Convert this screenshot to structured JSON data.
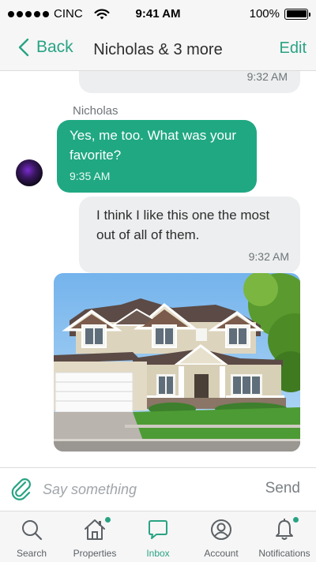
{
  "status_bar": {
    "carrier": "CINC",
    "time": "9:41 AM",
    "battery": "100%",
    "battery_level": 1.0
  },
  "nav": {
    "back_label": "Back",
    "title": "Nicholas & 3 more",
    "edit_label": "Edit"
  },
  "messages": [
    {
      "direction": "outgoing",
      "text": "",
      "time": "9:32 AM"
    },
    {
      "direction": "incoming",
      "sender": "Nicholas",
      "text": "Yes, me too. What was your favorite?",
      "time": "9:35 AM"
    },
    {
      "direction": "outgoing",
      "text": "I think I like this one the most out of all of them.",
      "time": "9:32 AM"
    },
    {
      "direction": "incoming",
      "type": "image",
      "image_icon": "house-photo"
    }
  ],
  "composer": {
    "placeholder": "Say something",
    "value": "",
    "send_label": "Send",
    "attach_icon": "paperclip-icon"
  },
  "tabs": [
    {
      "label": "Search",
      "icon": "search-icon",
      "active": false,
      "badge": false
    },
    {
      "label": "Properties",
      "icon": "house-icon",
      "active": false,
      "badge": true
    },
    {
      "label": "Inbox",
      "icon": "chat-bubble-icon",
      "active": true,
      "badge": false
    },
    {
      "label": "Account",
      "icon": "user-icon",
      "active": false,
      "badge": false
    },
    {
      "label": "Notifications",
      "icon": "bell-icon",
      "active": false,
      "badge": true
    }
  ],
  "colors": {
    "accent": "#29a383",
    "incoming_bubble": "#20a883",
    "outgoing_bubble": "#eceeef",
    "bar_background": "#f6f6f6"
  }
}
